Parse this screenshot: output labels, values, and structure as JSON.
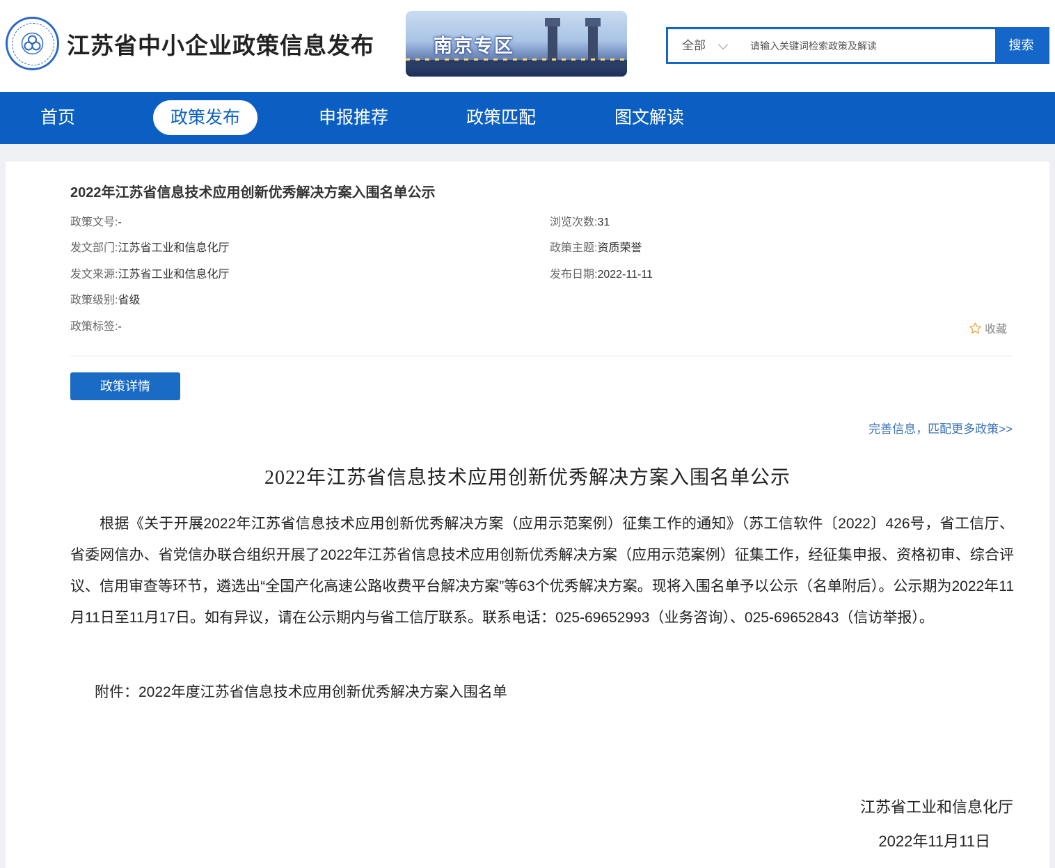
{
  "header": {
    "site_title": "江苏省中小企业政策信息发布",
    "banner_text": "南京专区",
    "search": {
      "scope": "全部",
      "placeholder": "请输入关键词检索政策及解读",
      "button_label": "搜索"
    }
  },
  "nav": {
    "items": [
      {
        "label": "首页",
        "active": false
      },
      {
        "label": "政策发布",
        "active": true
      },
      {
        "label": "申报推荐",
        "active": false
      },
      {
        "label": "政策匹配",
        "active": false
      },
      {
        "label": "图文解读",
        "active": false
      }
    ]
  },
  "policy": {
    "title": "2022年江苏省信息技术应用创新优秀解决方案入围名单公示",
    "meta_left": [
      {
        "key": "政策文号:",
        "value": "-"
      },
      {
        "key": "发文部门:",
        "value": "江苏省工业和信息化厅"
      },
      {
        "key": "发文来源:",
        "value": "江苏省工业和信息化厅"
      },
      {
        "key": "政策级别:",
        "value": "省级"
      },
      {
        "key": "政策标签:",
        "value": "-"
      }
    ],
    "meta_right": [
      {
        "key": "浏览次数:",
        "value": "31"
      },
      {
        "key": "政策主题:",
        "value": "资质荣誉"
      },
      {
        "key": "发布日期:",
        "value": "2022-11-11"
      }
    ],
    "favorite_label": "收藏",
    "tab_label": "政策详情",
    "more_link": "完善信息，匹配更多政策>>"
  },
  "article": {
    "title": "2022年江苏省信息技术应用创新优秀解决方案入围名单公示",
    "paragraph1": "根据《关于开展2022年江苏省信息技术应用创新优秀解决方案（应用示范案例）征集工作的通知》（苏工信软件〔2022〕426号，省工信厅、省委网信办、省党信办联合组织开展了2022年江苏省信息技术应用创新优秀解决方案（应用示范案例）征集工作，经征集申报、资格初审、综合评议、信用审查等环节，遴选出“全国产化高速公路收费平台解决方案”等63个优秀解决方案。现将入围名单予以公示（名单附后）。公示期为2022年11月11日至11月17日。如有异议，请在公示期内与省工信厅联系。联系电话：025-69652993（业务咨询）、025-69652843（信访举报）。",
    "attachment": "附件：2022年度江苏省信息技术应用创新优秀解决方案入围名单",
    "signature_org": "江苏省工业和信息化厅",
    "signature_date": "2022年11月11日"
  }
}
